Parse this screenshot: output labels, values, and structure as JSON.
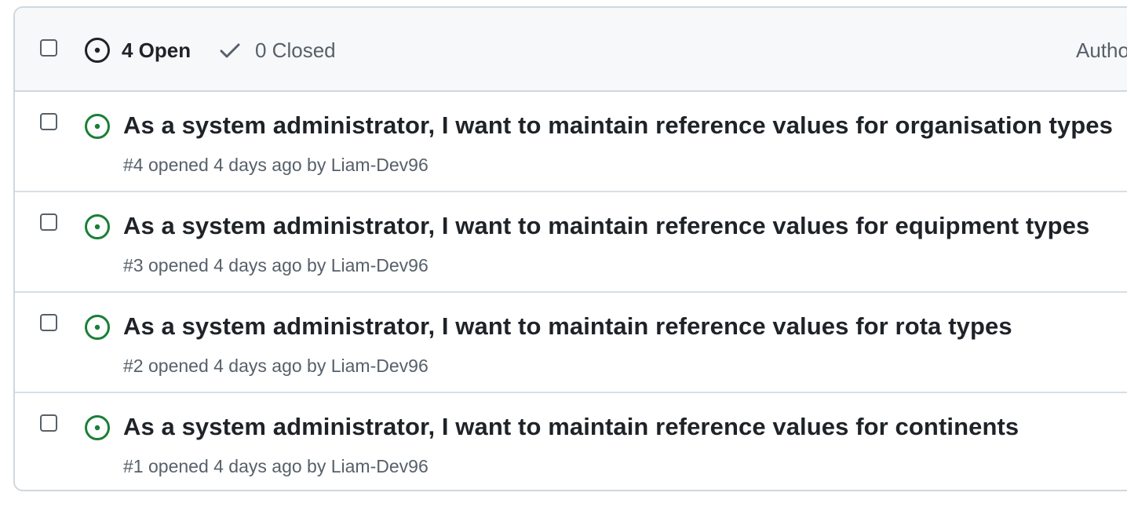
{
  "header": {
    "open_count_label": "4 Open",
    "closed_count_label": "0 Closed",
    "author_filter_label": "Author"
  },
  "issues": [
    {
      "title": "As a system administrator, I want to maintain reference values for organisation types",
      "number": "#4",
      "opened_text": "opened 4 days ago by",
      "author": "Liam-Dev96"
    },
    {
      "title": "As a system administrator, I want to maintain reference values for equipment types",
      "number": "#3",
      "opened_text": "opened 4 days ago by",
      "author": "Liam-Dev96"
    },
    {
      "title": "As a system administrator, I want to maintain reference values for rota types",
      "number": "#2",
      "opened_text": "opened 4 days ago by",
      "author": "Liam-Dev96"
    },
    {
      "title": "As a system administrator, I want to maintain reference values for continents",
      "number": "#1",
      "opened_text": "opened 4 days ago by",
      "author": "Liam-Dev96"
    }
  ],
  "icons": {
    "open_issue": "issue-opened-icon",
    "check": "check-icon"
  },
  "colors": {
    "open_green": "#1a7f37",
    "text_primary": "#1f2328",
    "text_muted": "#57606a",
    "header_bg": "#f6f8fa",
    "border": "#d0d7de"
  }
}
